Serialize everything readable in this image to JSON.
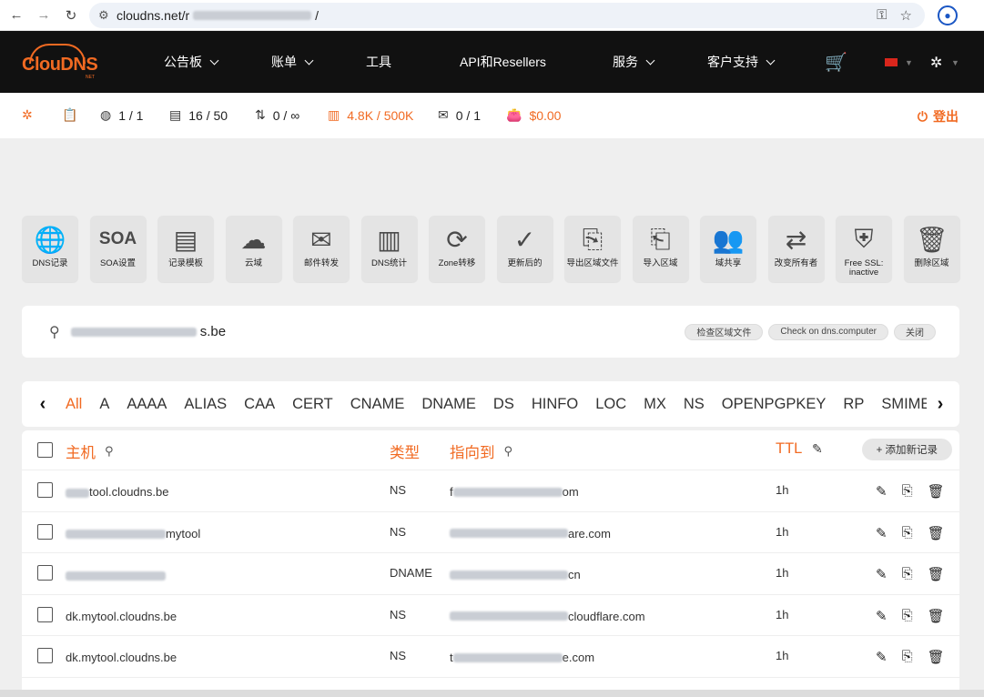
{
  "browser": {
    "url_visible": "cloudns.net/r",
    "url_tail": "/"
  },
  "nav": {
    "logo_text": "ClouDNS",
    "logo_sub": "NET",
    "items": [
      {
        "label": "公告板",
        "has_caret": true
      },
      {
        "label": "账单",
        "has_caret": true
      },
      {
        "label": "工具",
        "has_caret": false
      },
      {
        "label": "API和Resellers",
        "has_caret": false
      },
      {
        "label": "服务",
        "has_caret": true
      },
      {
        "label": "客户支持",
        "has_caret": true
      }
    ]
  },
  "stats": {
    "zones": "1 / 1",
    "records": "16 / 50",
    "transfers": "0 / ∞",
    "queries": "4.8K / 500K",
    "mail": "0 / 1",
    "balance": "$0.00",
    "logout": "登出"
  },
  "tools": [
    {
      "label": "DNS记录",
      "icon": "globe-icon",
      "glyph": "🌐"
    },
    {
      "label": "SOA设置",
      "icon": "soa-icon",
      "glyph": "SOA"
    },
    {
      "label": "记录模板",
      "icon": "template-icon",
      "glyph": "▤"
    },
    {
      "label": "云域",
      "icon": "cloud-icon",
      "glyph": "☁"
    },
    {
      "label": "邮件转发",
      "icon": "mail-forward-icon",
      "glyph": "✉"
    },
    {
      "label": "DNS统计",
      "icon": "stats-icon",
      "glyph": "▥"
    },
    {
      "label": "Zone转移",
      "icon": "zone-transfer-icon",
      "glyph": "⟳"
    },
    {
      "label": "更新后的",
      "icon": "check-icon",
      "glyph": "✓"
    },
    {
      "label": "导出区域文件",
      "icon": "export-icon",
      "glyph": "⎘"
    },
    {
      "label": "导入区域",
      "icon": "import-icon",
      "glyph": "⎗"
    },
    {
      "label": "域共享",
      "icon": "users-icon",
      "glyph": "👥"
    },
    {
      "label": "改变所有者",
      "icon": "owner-icon",
      "glyph": "⇄"
    },
    {
      "label": "Free SSL: inactive",
      "icon": "ssl-icon",
      "glyph": "⛨"
    },
    {
      "label": "删除区域",
      "icon": "trash-icon",
      "glyph": "🗑"
    }
  ],
  "domain": {
    "name_suffix": "s.be",
    "chips": [
      "检查区域文件",
      "Check on dns.computer",
      "关闭"
    ]
  },
  "record_types": [
    "All",
    "A",
    "AAAA",
    "ALIAS",
    "CAA",
    "CERT",
    "CNAME",
    "DNAME",
    "DS",
    "HINFO",
    "LOC",
    "MX",
    "NS",
    "OPENPGPKEY",
    "RP",
    "SMIME"
  ],
  "table": {
    "headers": {
      "host": "主机",
      "type": "类型",
      "points_to": "指向到",
      "ttl": "TTL"
    },
    "add_label": "+ 添加新记录",
    "rows": [
      {
        "host": "tool.cloudns.be",
        "type": "NS",
        "ptr_prefix": "f",
        "ptr_suffix": "om",
        "ttl": "1h"
      },
      {
        "host": "mytool",
        "type": "NS",
        "ptr_prefix": "",
        "ptr_suffix": "are.com",
        "ttl": "1h"
      },
      {
        "host": "",
        "type": "DNAME",
        "ptr_prefix": "",
        "ptr_suffix": "cn",
        "ttl": "1h"
      },
      {
        "host": "dk.mytool.cloudns.be",
        "type": "NS",
        "ptr_prefix": "",
        "ptr_suffix": "cloudflare.com",
        "ttl": "1h"
      },
      {
        "host": "dk.mytool.cloudns.be",
        "type": "NS",
        "ptr_prefix": "t",
        "ptr_suffix": "e.com",
        "ttl": "1h"
      }
    ]
  }
}
